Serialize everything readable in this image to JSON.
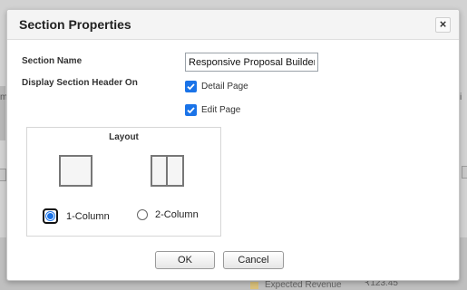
{
  "dialog": {
    "title": "Section Properties",
    "close_label": "×"
  },
  "fields": {
    "section_name_label": "Section Name",
    "section_name_value": "Responsive Proposal Builder",
    "display_header_label": "Display Section Header On",
    "detail_page_label": "Detail Page",
    "detail_page_checked": true,
    "edit_page_label": "Edit Page",
    "edit_page_checked": true
  },
  "layout": {
    "title": "Layout",
    "options": [
      {
        "label": "1-Column",
        "selected": true
      },
      {
        "label": "2-Column",
        "selected": false
      }
    ]
  },
  "buttons": {
    "ok_label": "OK",
    "cancel_label": "Cancel"
  },
  "background": {
    "left_fragment": "m",
    "right_fragment": "i",
    "footer_item_label": "Expected Revenue",
    "footer_item_value": "₹123.45"
  },
  "colors": {
    "accent": "#1a73e8",
    "overlay": "#d2d2d2"
  }
}
